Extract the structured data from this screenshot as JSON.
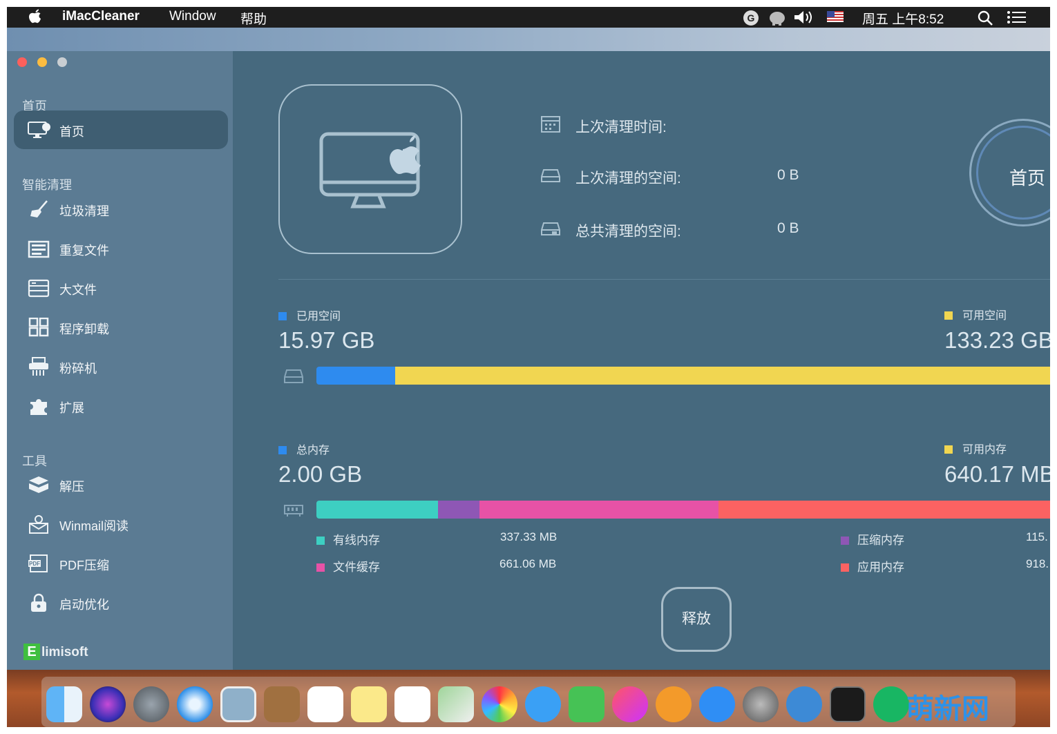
{
  "menubar": {
    "app_name": "iMacCleaner",
    "menu_window": "Window",
    "menu_help": "帮助",
    "clock": "周五 上午8:52"
  },
  "sidebar": {
    "section_home": "首页",
    "home_item": "首页",
    "section_smart": "智能清理",
    "smart_items": [
      {
        "label": "垃圾清理",
        "icon": "broom-icon"
      },
      {
        "label": "重复文件",
        "icon": "duplicate-files-icon"
      },
      {
        "label": "大文件",
        "icon": "large-file-icon"
      },
      {
        "label": "程序卸载",
        "icon": "app-grid-icon"
      },
      {
        "label": "粉碎机",
        "icon": "shredder-icon"
      },
      {
        "label": "扩展",
        "icon": "puzzle-icon"
      }
    ],
    "section_tools": "工具",
    "tool_items": [
      {
        "label": "解压",
        "icon": "box-icon"
      },
      {
        "label": "Winmail阅读",
        "icon": "mail-reader-icon"
      },
      {
        "label": "PDF压缩",
        "icon": "pdf-icon"
      },
      {
        "label": "启动优化",
        "icon": "lock-icon"
      }
    ],
    "brand": "limisoft"
  },
  "main": {
    "last_clean_time_label": "上次清理时间:",
    "last_clean_space_label": "上次清理的空间:",
    "last_clean_space_value": "0 B",
    "total_clean_space_label": "总共清理的空间:",
    "total_clean_space_value": "0 B",
    "gauge_label": "首页",
    "disk": {
      "used_label": "已用空间",
      "used_value": "15.97 GB",
      "free_label": "可用空间",
      "free_value": "133.23 GB",
      "used_fraction": 0.107
    },
    "memory": {
      "total_label": "总内存",
      "total_value": "2.00 GB",
      "free_label": "可用内存",
      "free_value": "640.17 MB",
      "items": [
        {
          "label": "有线内存",
          "value": "337.33 MB",
          "color": "#3dcfc2"
        },
        {
          "label": "压缩内存",
          "value": "115.",
          "color": "#8e57b5"
        },
        {
          "label": "文件缓存",
          "value": "661.06 MB",
          "color": "#e752a6"
        },
        {
          "label": "应用内存",
          "value": "918.",
          "color": "#fb6262"
        }
      ]
    },
    "release_button": "释放"
  },
  "colors": {
    "blue": "#2e8bef",
    "yellow": "#f1d651"
  },
  "watermark": "萌新网"
}
